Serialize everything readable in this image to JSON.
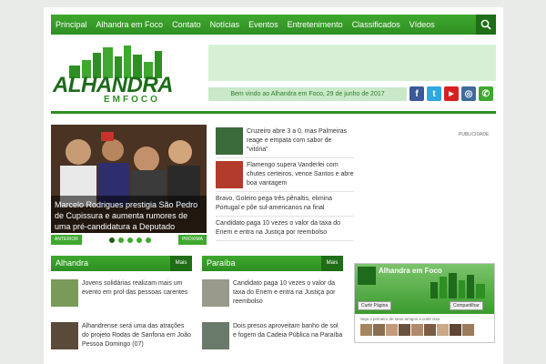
{
  "nav": {
    "items": [
      "Principal",
      "Alhandra em Foco",
      "Contato",
      "Notícias",
      "Eventos",
      "Entretenimento",
      "Classificados",
      "Vídeos"
    ],
    "search_icon": "search-icon"
  },
  "logo": {
    "title": "ALHANDRA",
    "subtitle": "EMFOCO"
  },
  "welcome": "Bem vindo ao Alhandra em Foco, 29 de junho de 2017",
  "social": [
    {
      "icon": "facebook-icon",
      "glyph": "f",
      "color": "#3b5998"
    },
    {
      "icon": "twitter-icon",
      "glyph": "t",
      "color": "#2fa8e0"
    },
    {
      "icon": "youtube-icon",
      "glyph": "▶",
      "color": "#d81f1f"
    },
    {
      "icon": "instagram-icon",
      "glyph": "◎",
      "color": "#3f6b9b"
    },
    {
      "icon": "whatsapp-icon",
      "glyph": "✆",
      "color": "#3fa82f"
    }
  ],
  "slider": {
    "caption": "Marcelo Rodrigues prestigia São Pedro de Cupissura e aumenta rumores de uma pré-candidatura a Deputado Estadual",
    "prev_label": "ANTERIOR",
    "next_label": "PRÓXIMA"
  },
  "news": [
    "Cruzeiro abre 3 a 0, mas Palmeiras reage e empata com sabor de \"vitória\"",
    "Flamengo supera Vanderlei com chutes certeiros, vence Santos e abre boa vantagem",
    "Bravo, Goleiro pega três pênaltis, elimina Portugal e põe sul-americanos na final",
    "Candidato paga 10 vezes o valor da taxa do Enem e entra na Justiça por reembolso"
  ],
  "publicidade": "PUBLICIDADE",
  "sections": {
    "alhandra": {
      "title": "Alhandra",
      "more": "Mais",
      "items": [
        "Jovens solidárias realizam mais um evento em prol das pessoas carentes",
        "Alhandrense será uma das atrações do projeto Rodas de Sanfona em João Pessoa Domingo (07)"
      ]
    },
    "paraiba": {
      "title": "Paraíba",
      "more": "Mais",
      "items": [
        "Candidato paga 10 vezes o valor da taxa do Enem e entra na Justiça por reembolso",
        "Dois presos aproveitam banho de sol e fogem da Cadeia Pública na Paraíba"
      ]
    }
  },
  "facebook": {
    "page_name": "Alhandra em Foco",
    "like_label": "Curtir Página",
    "share_label": "Compartilhar",
    "friends_text": "Seja o primeiro de seus amigos a curtir isso"
  },
  "colors": {
    "brand_green": "#2e8f22",
    "dark_green": "#1f6d16",
    "light_green": "#d7f0d5"
  }
}
